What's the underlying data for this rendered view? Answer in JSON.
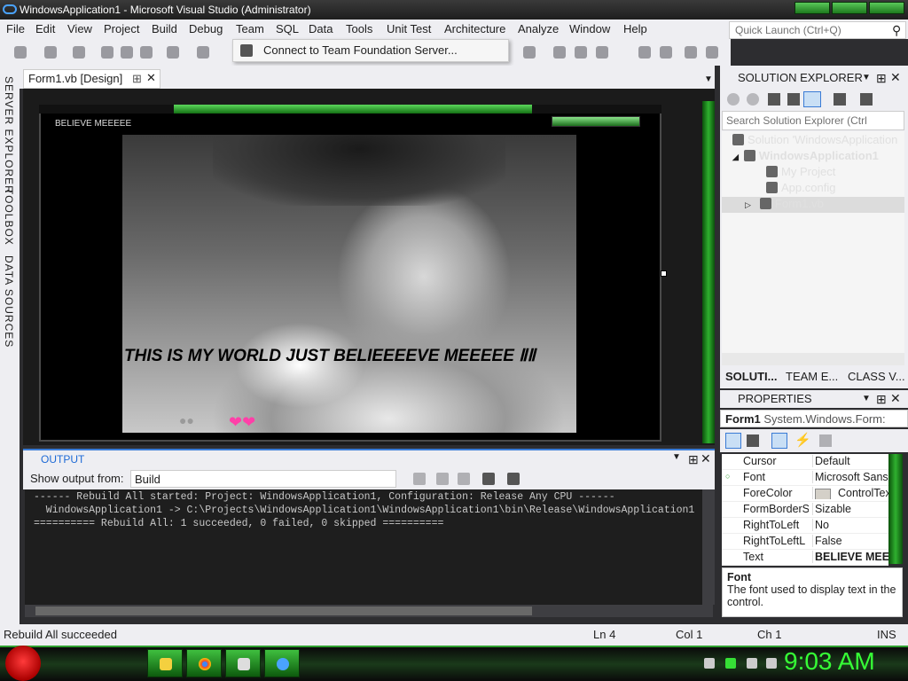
{
  "window": {
    "title": "WindowsApplication1 - Microsoft Visual Studio (Administrator)"
  },
  "menu": [
    "File",
    "Edit",
    "View",
    "Project",
    "Build",
    "Debug",
    "Team",
    "SQL",
    "Data",
    "Tools",
    "Unit Test",
    "Architecture",
    "Analyze",
    "Window",
    "Help"
  ],
  "quick_launch": {
    "placeholder": "Quick Launch (Ctrl+Q)"
  },
  "team_menu": {
    "item": "Connect to Team Foundation Server..."
  },
  "left_rail": [
    "SERVER EXPLORER",
    "TOOLBOX",
    "DATA SOURCES"
  ],
  "doc_tab": {
    "label": "Form1.vb [Design]"
  },
  "form": {
    "title": "BELIEVE MEEEEE",
    "caption": "THIS IS MY WORLD JUST BELIEEEEVE MEEEEE ⅡⅡ"
  },
  "output": {
    "header": "OUTPUT",
    "show_from_label": "Show output from:",
    "source": "Build",
    "lines": [
      "------ Rebuild All started: Project: WindowsApplication1, Configuration: Release Any CPU ------",
      "  WindowsApplication1 -> C:\\Projects\\WindowsApplication1\\WindowsApplication1\\bin\\Release\\WindowsApplication1",
      "========== Rebuild All: 1 succeeded, 0 failed, 0 skipped =========="
    ]
  },
  "solution_explorer": {
    "header": "SOLUTION EXPLORER",
    "search_placeholder": "Search Solution Explorer (Ctrl",
    "tree": [
      {
        "label": "Solution 'WindowsApplication",
        "icon": "solution-icon"
      },
      {
        "label": "WindowsApplication1",
        "icon": "vb-project-icon"
      },
      {
        "label": "My Project",
        "icon": "wrench-icon"
      },
      {
        "label": "App.config",
        "icon": "config-icon"
      },
      {
        "label": "Form1.vb",
        "icon": "form-icon"
      }
    ],
    "tabs": [
      "SOLUTI...",
      "TEAM E...",
      "CLASS V..."
    ]
  },
  "properties": {
    "header": "PROPERTIES",
    "object": "Form1",
    "object_type": "System.Windows.Form:",
    "rows": [
      {
        "name": "Cursor",
        "value": "Default"
      },
      {
        "name": "Font",
        "value": "Microsoft Sans"
      },
      {
        "name": "ForeColor",
        "value": "ControlTex"
      },
      {
        "name": "FormBorderS",
        "value": "Sizable"
      },
      {
        "name": "RightToLeft",
        "value": "No"
      },
      {
        "name": "RightToLeftL",
        "value": "False"
      },
      {
        "name": "Text",
        "value": "BELIEVE MEE"
      }
    ],
    "desc_title": "Font",
    "desc_text": "The font used to display text in the control."
  },
  "status": {
    "message": "Rebuild All succeeded",
    "ln": "Ln 4",
    "col": "Col 1",
    "ch": "Ch 1",
    "mode": "INS"
  },
  "taskbar": {
    "clock": "9:03 AM"
  }
}
